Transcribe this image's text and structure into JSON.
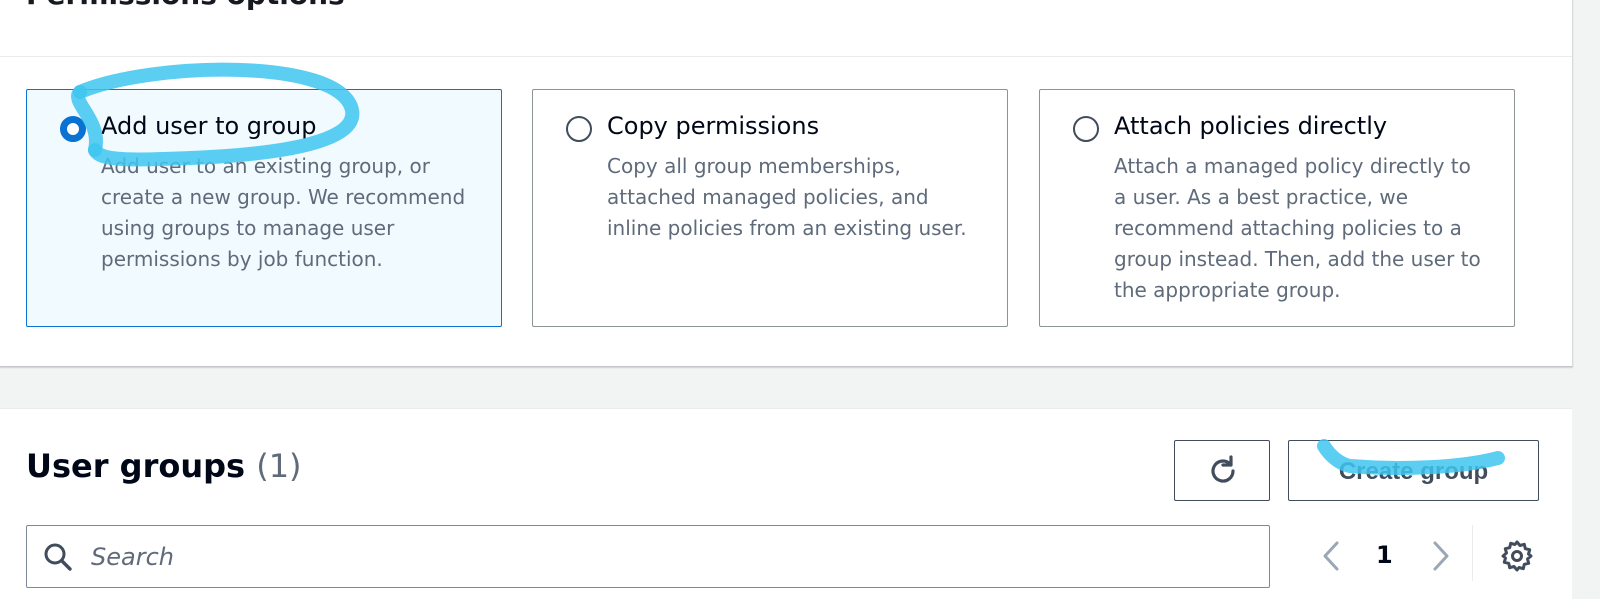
{
  "permissions": {
    "title": "Permissions options",
    "options": [
      {
        "label": "Add user to group",
        "description": "Add user to an existing group, or create a new group. We recommend using groups to manage user permissions by job function.",
        "selected": true
      },
      {
        "label": "Copy permissions",
        "description": "Copy all group memberships, attached managed policies, and inline policies from an existing user.",
        "selected": false
      },
      {
        "label": "Attach policies directly",
        "description": "Attach a managed policy directly to a user. As a best practice, we recommend attaching policies to a group instead. Then, add the user to the appropriate group.",
        "selected": false
      }
    ]
  },
  "user_groups": {
    "title": "User groups",
    "count": "(1)",
    "refresh_icon": "refresh-icon",
    "create_label": "Create group",
    "search": {
      "placeholder": "Search",
      "value": ""
    },
    "pagination": {
      "current_page": "1"
    },
    "settings_icon": "gear-icon"
  },
  "colors": {
    "accent": "#0972d3",
    "annotation": "#3ec6f0",
    "text_secondary": "#5f6b7a"
  }
}
